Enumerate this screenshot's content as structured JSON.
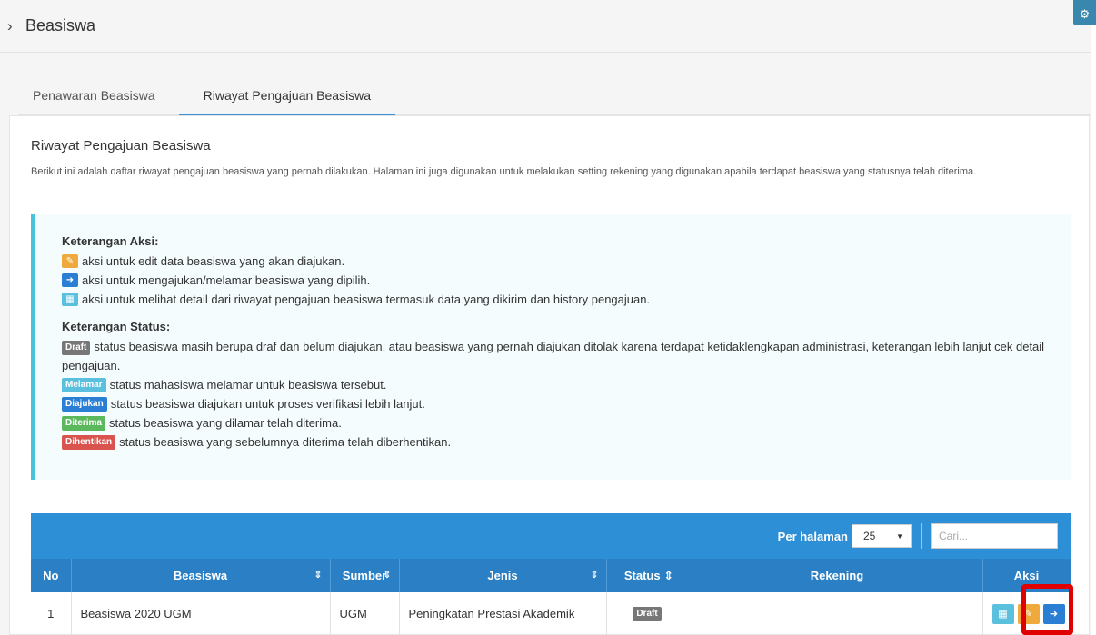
{
  "header": {
    "title": "Beasiswa",
    "chevron": "›"
  },
  "tabs": [
    {
      "label": "Penawaran Beasiswa",
      "active": false
    },
    {
      "label": "Riwayat Pengajuan Beasiswa",
      "active": true
    }
  ],
  "panel": {
    "title": "Riwayat Pengajuan Beasiswa",
    "description": "Berikut ini adalah daftar riwayat pengajuan beasiswa yang pernah dilakukan. Halaman ini juga digunakan untuk melakukan setting rekening yang digunakan apabila terdapat beasiswa yang statusnya telah diterima."
  },
  "legend": {
    "aksi_title": "Keterangan Aksi:",
    "aksi_edit": "aksi untuk edit data beasiswa yang akan diajukan.",
    "aksi_apply": "aksi untuk mengajukan/melamar beasiswa yang dipilih.",
    "aksi_detail": "aksi untuk melihat detail dari riwayat pengajuan beasiswa termasuk data yang dikirim dan history pengajuan.",
    "status_title": "Keterangan Status:",
    "draft_badge": "Draft",
    "draft_text": "status beasiswa masih berupa draf dan belum diajukan, atau beasiswa yang pernah diajukan ditolak karena terdapat ketidaklengkapan administrasi, keterangan lebih lanjut cek detail pengajuan.",
    "melamar_badge": "Melamar",
    "melamar_text": "status mahasiswa melamar untuk beasiswa tersebut.",
    "diajukan_badge": "Diajukan",
    "diajukan_text": "status beasiswa diajukan untuk proses verifikasi lebih lanjut.",
    "diterima_badge": "Diterima",
    "diterima_text": "status beasiswa yang dilamar telah diterima.",
    "dihentikan_badge": "Dihentikan",
    "dihentikan_text": "status beasiswa yang sebelumnya diterima telah diberhentikan."
  },
  "table": {
    "per_page_label": "Per halaman",
    "per_page_value": "25",
    "search_placeholder": "Cari...",
    "columns": [
      "No",
      "Beasiswa",
      "Sumber",
      "Jenis",
      "Status",
      "Rekening",
      "Aksi"
    ],
    "rows": [
      {
        "no": "1",
        "beasiswa": "Beasiswa 2020 UGM",
        "sumber": "UGM",
        "jenis": "Peningkatan Prestasi Akademik",
        "status": "Draft",
        "rekening": ""
      }
    ]
  },
  "colors": {
    "toolbar": "#2d8fd5",
    "header_row": "#2a7fc5",
    "highlight": "#e00000"
  },
  "icons": [
    "chevron-right-icon",
    "gear-icon",
    "edit-icon",
    "arrow-right-icon",
    "grid-icon",
    "sort-icon",
    "caret-down-icon"
  ]
}
